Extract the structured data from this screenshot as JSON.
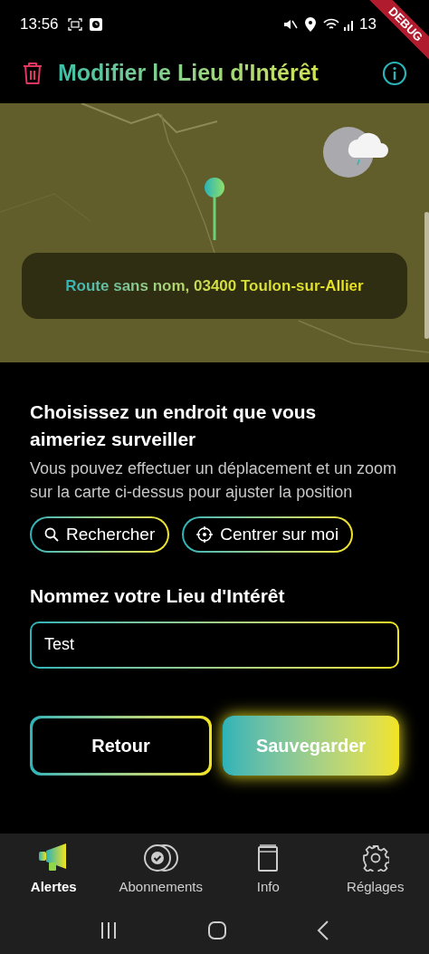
{
  "status_bar": {
    "time": "13:56",
    "battery": "13"
  },
  "debug_banner": "DEBUG",
  "header": {
    "title": "Modifier le Lieu d'Intérêt"
  },
  "map": {
    "kind": "picture",
    "address": "Route sans nom, 03400 Toulon-sur-Allier"
  },
  "location": {
    "heading": "Choisissez un endroit que vous aimeriez surveiller",
    "description": "Vous pouvez effectuer un déplacement et un zoom sur la carte ci-dessus pour ajuster la position",
    "buttons": [
      {
        "kind": "search",
        "label": "Rechercher"
      },
      {
        "kind": "locate",
        "label": "Centrer sur moi"
      }
    ]
  },
  "name": {
    "label": "Nommez votre Lieu d'Intérêt",
    "value": "Test"
  },
  "actions": [
    {
      "kind": "secondary",
      "label": "Retour"
    },
    {
      "kind": "primary",
      "label": "Sauvegarder"
    }
  ],
  "nav": [
    {
      "kind": "alerts",
      "label": "Alertes",
      "selected": true
    },
    {
      "kind": "subscriptions",
      "label": "Abonnements",
      "selected": false
    },
    {
      "kind": "info",
      "label": "Info",
      "selected": false
    },
    {
      "kind": "settings",
      "label": "Réglages",
      "selected": false
    }
  ]
}
